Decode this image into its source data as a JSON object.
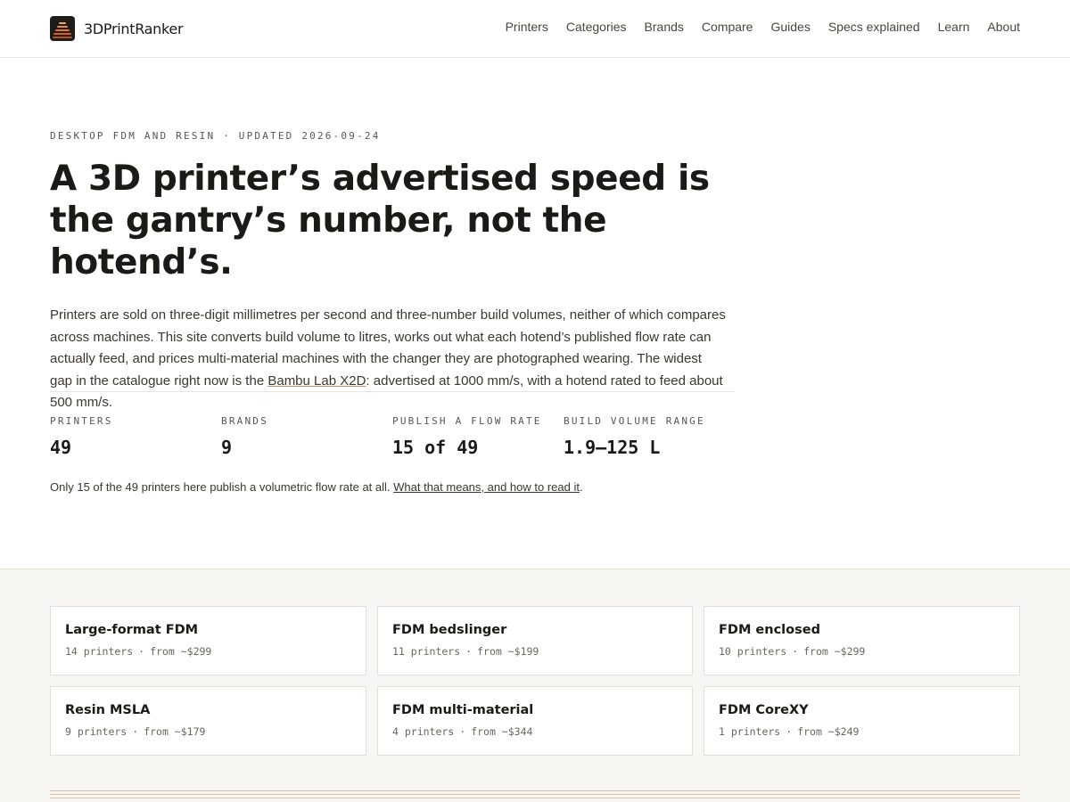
{
  "site": {
    "name": "3DPrintRanker"
  },
  "nav": {
    "items": [
      "Printers",
      "Categories",
      "Brands",
      "Compare",
      "Guides",
      "Specs explained",
      "Learn",
      "About"
    ]
  },
  "hero": {
    "eyebrow": "Desktop FDM and resin · Updated 2026-09-24",
    "title": "A 3D printer’s advertised speed is the gantry’s number, not the hotend’s.",
    "lede_before": "Printers are sold on three-digit millimetres per second and three-number build volumes, neither of which compares across machines. This site converts build volume to litres, works out what each hotend’s published flow rate can actually feed, and prices multi-material machines with the changer they are photographed wearing. The widest gap in the catalogue right now is the ",
    "lede_link": "Bambu Lab X2D",
    "lede_after": ": advertised at 1000 mm/s, with a hotend rated to feed about 500 mm/s."
  },
  "stats": [
    {
      "label": "Printers",
      "value": "49"
    },
    {
      "label": "Brands",
      "value": "9"
    },
    {
      "label": "Publish a flow rate",
      "value": "15 of 49"
    },
    {
      "label": "Build volume range",
      "value": "1.9–125 L"
    }
  ],
  "note": {
    "text": "Only 15 of the 49 printers here publish a volumetric flow rate at all. ",
    "link": "What that means, and how to read it",
    "end": "."
  },
  "categories": [
    {
      "name": "Large-format FDM",
      "count": "14 printers",
      "price": "from ~$299"
    },
    {
      "name": "FDM bedslinger",
      "count": "11 printers",
      "price": "from ~$199"
    },
    {
      "name": "FDM enclosed",
      "count": "10 printers",
      "price": "from ~$299"
    },
    {
      "name": "Resin MSLA",
      "count": "9 printers",
      "price": "from ~$179"
    },
    {
      "name": "FDM multi-material",
      "count": "4 printers",
      "price": "from ~$344"
    },
    {
      "name": "FDM CoreXY",
      "count": "1 printers",
      "price": "from ~$249"
    }
  ],
  "colors": {
    "accent": "#e8742c",
    "text": "#1c1a17",
    "band": "#f8f6f2"
  },
  "icons": {
    "logo": "layered-print-icon"
  }
}
